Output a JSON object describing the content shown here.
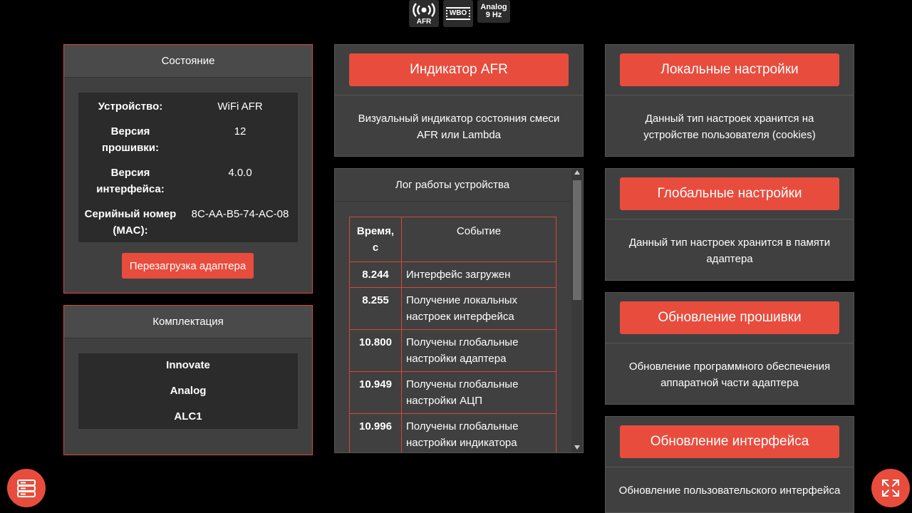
{
  "topbar": {
    "afr_label": "AFR",
    "wbo_label": "WBO",
    "analog_label": "Analog",
    "analog_freq": "9 Hz"
  },
  "status": {
    "title": "Состояние",
    "rows": [
      {
        "key": "Устройство:",
        "value": "WiFi AFR"
      },
      {
        "key": "Версия прошивки:",
        "value": "12"
      },
      {
        "key": "Версия интерфейса:",
        "value": "4.0.0"
      },
      {
        "key": "Серийный номер (MAC):",
        "value": "8C-AA-B5-74-AC-08"
      }
    ],
    "reboot_label": "Перезагрузка адаптера"
  },
  "kit": {
    "title": "Комплектация",
    "items": [
      "Innovate",
      "Analog",
      "ALC1"
    ]
  },
  "afr_card": {
    "button": "Индикатор AFR",
    "desc": "Визуальный индикатор состояния смеси AFR или Lambda"
  },
  "log": {
    "title": "Лог работы устройства",
    "col_time": "Время, с",
    "col_event": "Событие",
    "rows": [
      {
        "time": "8.244",
        "event": "Интерфейс загружен"
      },
      {
        "time": "8.255",
        "event": "Получение локальных настроек интерфейса"
      },
      {
        "time": "10.800",
        "event": "Получены глобальные настройки адаптера"
      },
      {
        "time": "10.949",
        "event": "Получены глобальные настройки АЦП"
      },
      {
        "time": "10.996",
        "event": "Получены глобальные настройки индикатора"
      }
    ]
  },
  "cards": {
    "local": {
      "button": "Локальные настройки",
      "desc": "Данный тип настроек хранится на устройстве пользователя (cookies)"
    },
    "global": {
      "button": "Глобальные настройки",
      "desc": "Данный тип настроек хранится в памяти адаптера"
    },
    "firmware": {
      "button": "Обновление прошивки",
      "desc": "Обновление программного обеспечения аппаратной части адаптера"
    },
    "interface": {
      "button": "Обновление интерфейса",
      "desc": "Обновление пользовательского интерфейса"
    }
  },
  "colors": {
    "accent": "#e84c3d",
    "panel": "#404040",
    "inner": "#2b2b2b"
  },
  "icons": {
    "left_fab": "server-icon",
    "right_fab": "fullscreen-icon"
  }
}
